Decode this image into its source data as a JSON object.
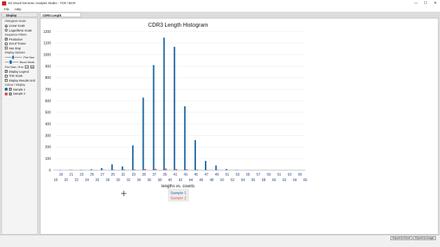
{
  "window": {
    "title": "ird Visual Genomic Analysis Studio - TCR / BCR",
    "minimize_glyph": "—",
    "maximize_glyph": "☐",
    "close_glyph": "✕"
  },
  "menu": {
    "file": "File",
    "help": "Help"
  },
  "left_panel": {
    "header": "Display Parameters",
    "histogram_scale_label": "Histogram Scale",
    "linear_scale": "Linear Scale",
    "logarithmic_scale": "Logarithmic Scale",
    "sequence_filters_label": "Sequence Filters",
    "productive": "Productive",
    "out_of_frame": "Out of Frame",
    "has_stop": "Has Stop",
    "display_options_label": "Display Options",
    "plot_size": "Plot Size",
    "block_width": "Block Width",
    "plot_start_end": "Plot Start / End",
    "start_value": "19",
    "end_value": "66",
    "display_legend": "Display Legend",
    "trim_scale": "Trim Scale",
    "display_results_grid": "Display Results Grid",
    "colour_display_label": "Colour / Display",
    "sample1": "Sample 1",
    "sample2": "Sample 2",
    "slider_plot_size": 0.45,
    "slider_block_width": 0.3
  },
  "tab": {
    "label": "CDR3 Length"
  },
  "colors": {
    "sample1": "#1f6aa5",
    "sample2": "#d9534f",
    "grid": "#e6e6e6"
  },
  "chart_data": {
    "type": "bar",
    "title": "CDR3 Length Histogram",
    "xlabel": "lengths vs. counts",
    "ylabel": "",
    "ylim": [
      0,
      1200
    ],
    "yticks": [
      0,
      100,
      200,
      300,
      400,
      500,
      600,
      700,
      800,
      900,
      1000,
      1100,
      1200
    ],
    "categories": [
      18,
      19,
      20,
      21,
      22,
      23,
      24,
      25,
      26,
      27,
      28,
      29,
      30,
      31,
      32,
      33,
      34,
      35,
      36,
      37,
      38,
      39,
      40,
      41,
      42,
      43,
      44,
      45,
      46,
      47,
      48,
      49,
      50,
      51,
      52,
      53,
      54,
      55,
      56,
      57,
      58,
      59,
      60,
      61,
      62,
      63,
      64,
      65,
      66
    ],
    "series": [
      {
        "name": "Sample 1",
        "values": [
          0,
          2,
          0,
          3,
          0,
          3,
          0,
          7,
          0,
          18,
          0,
          50,
          0,
          32,
          0,
          215,
          0,
          628,
          0,
          910,
          0,
          1148,
          0,
          1068,
          0,
          553,
          0,
          260,
          0,
          80,
          0,
          40,
          0,
          10,
          0,
          2,
          0,
          0,
          0,
          0,
          0,
          0,
          0,
          0,
          0,
          0,
          0,
          0,
          0
        ]
      },
      {
        "name": "Sample 2",
        "values": [
          0,
          0,
          0,
          1,
          0,
          1,
          0,
          2,
          0,
          3,
          0,
          4,
          0,
          5,
          0,
          5,
          0,
          10,
          0,
          12,
          0,
          15,
          0,
          10,
          0,
          8,
          0,
          5,
          0,
          3,
          0,
          2,
          0,
          1,
          0,
          0,
          0,
          0,
          0,
          0,
          0,
          0,
          0,
          0,
          0,
          0,
          0,
          0,
          0
        ]
      }
    ],
    "legend": [
      "Sample 1",
      "Sample 2"
    ],
    "legend_position": "bottom-center",
    "grid": true
  },
  "statusbar": {
    "export_excel": "Export to Excel",
    "export_image": "Export to Image"
  }
}
